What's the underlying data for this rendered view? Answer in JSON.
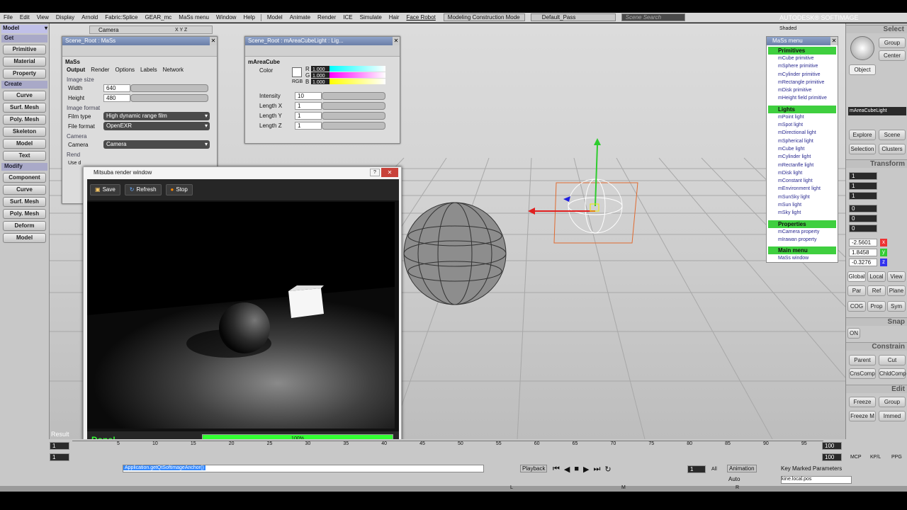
{
  "menubar": {
    "items": [
      "File",
      "Edit",
      "View",
      "Display",
      "Arnold",
      "Fabric:Splice",
      "GEAR_mc",
      "MaSs menu",
      "Window",
      "Help",
      "Model",
      "Animate",
      "Render",
      "ICE",
      "Simulate",
      "Hair",
      "Face Robot"
    ],
    "mode": "Modeling Construction Mode",
    "pass": "Default_Pass",
    "search_placeholder": "Scene Search",
    "brand": "AUTODESK® SOFTIMAGE"
  },
  "left": {
    "header": "Model",
    "sections": [
      {
        "title": "Get",
        "buttons": [
          "Primitive",
          "Material",
          "Property"
        ]
      },
      {
        "title": "Create",
        "buttons": [
          "Curve",
          "Surf. Mesh",
          "Poly. Mesh",
          "Skeleton",
          "Model",
          "Text"
        ]
      },
      {
        "title": "Modify",
        "buttons": [
          "Component",
          "Curve",
          "Surf. Mesh",
          "Poly. Mesh",
          "Deform",
          "Model"
        ]
      }
    ]
  },
  "viewport": {
    "camera": "Camera",
    "axes": "X Y Z",
    "shading": "Shaded",
    "result": "Result"
  },
  "mass_panel": {
    "title": "Scene_Root : MaSs",
    "section": "MaSs",
    "tabs": [
      "Output",
      "Render",
      "Options",
      "Labels",
      "Network"
    ],
    "image_size": "Image size",
    "width_label": "Width",
    "width": "640",
    "height_label": "Height",
    "height": "480",
    "image_format": "Image format",
    "film_type_label": "Film type",
    "film_type": "High dynamic range film",
    "file_format_label": "File format",
    "file_format": "OpenEXR",
    "camera_group": "Camera",
    "camera_label": "Camera",
    "camera": "Camera",
    "rend_label": "Rend",
    "use_label": "Use d"
  },
  "light_panel": {
    "title": "Scene_Root : mAreaCubeLight : Lig...",
    "section": "mAreaCube",
    "color_label": "Color",
    "rgb_label": "RGB",
    "r_label": "R",
    "r": "1.000",
    "g_label": "G",
    "g": "1.000",
    "b_label": "B",
    "b": "1.000",
    "intensity_label": "Intensity",
    "intensity": "10",
    "lx_label": "Length X",
    "lx": "1",
    "ly_label": "Length Y",
    "ly": "1",
    "lz_label": "Length Z",
    "lz": "1"
  },
  "mitsuba": {
    "title": "Mitsuba render window",
    "save": "Save",
    "refresh": "Refresh",
    "stop": "Stop",
    "status": "Done!",
    "progress_text": "100%",
    "progress": 1.0
  },
  "mass_menu": {
    "title": "MaSs menu",
    "groups": [
      {
        "title": "Primitives",
        "items": [
          "mCube primitive",
          "mSphere primitive",
          "mCylinder primitive",
          "mRectangle primitive",
          "mDisk primitive",
          "mHeight field primitive"
        ]
      },
      {
        "title": "Lights",
        "items": [
          "mPoint light",
          "mSpot light",
          "mDirectional light",
          "mSpherical light",
          "mCube light",
          "mCylinder light",
          "mRectanfle light",
          "mDisk light",
          "mConstant light",
          "mEnvironment light",
          "mSunSky light",
          "mSun light",
          "mSky light"
        ]
      },
      {
        "title": "Properties",
        "items": [
          "mCamera property",
          "mIrawan property"
        ]
      },
      {
        "title": "Main menu",
        "items": [
          "MaSs window"
        ]
      }
    ]
  },
  "right": {
    "select": "Select",
    "group": "Group",
    "center": "Center",
    "object": "Object",
    "selected_name": "mAreaCubeLight",
    "explore": "Explore",
    "scene": "Scene",
    "selection": "Selection",
    "clusters": "Clusters",
    "transform": "Transform",
    "t_x": "1",
    "t_y": "1",
    "t_z": "1",
    "r_x": "0",
    "r_y": "0",
    "r_z": "0",
    "p_x": "-2.5601",
    "p_y": "1.8458",
    "p_z": "-0.3276",
    "axis_labels": [
      "x",
      "y",
      "z"
    ],
    "global": "Global",
    "local": "Local",
    "view": "View",
    "par": "Par",
    "ref": "Ref",
    "plane": "Plane",
    "cog": "COG",
    "prop": "Prop",
    "sym": "Sym",
    "snap": "Snap",
    "on": "ON",
    "constrain": "Constrain",
    "parent": "Parent",
    "cut": "Cut",
    "cnscomp": "CnsComp",
    "chldcomp": "ChldComp",
    "edit": "Edit",
    "freeze": "Freeze",
    "group2": "Group",
    "freeze_m": "Freeze M",
    "immed": "Immed"
  },
  "timeline": {
    "start": "1",
    "start2": "1",
    "end": "100",
    "end2": "100",
    "ticks": [
      "5",
      "10",
      "15",
      "20",
      "25",
      "30",
      "35",
      "40",
      "45",
      "50",
      "55",
      "60",
      "65",
      "70",
      "75",
      "80",
      "85",
      "90",
      "95"
    ],
    "command": "Application.getQtSoftimageAnchor()",
    "playback": "Playback",
    "frame": "1",
    "all": "All",
    "animation": "Animation",
    "auto": "Auto",
    "key_marked": "Key Marked Parameters",
    "kine": "kine.local.pos",
    "mcp": "MCP",
    "kpl": "KP/L",
    "ppg": "PPG",
    "L": "L",
    "M": "M",
    "R": "R"
  }
}
